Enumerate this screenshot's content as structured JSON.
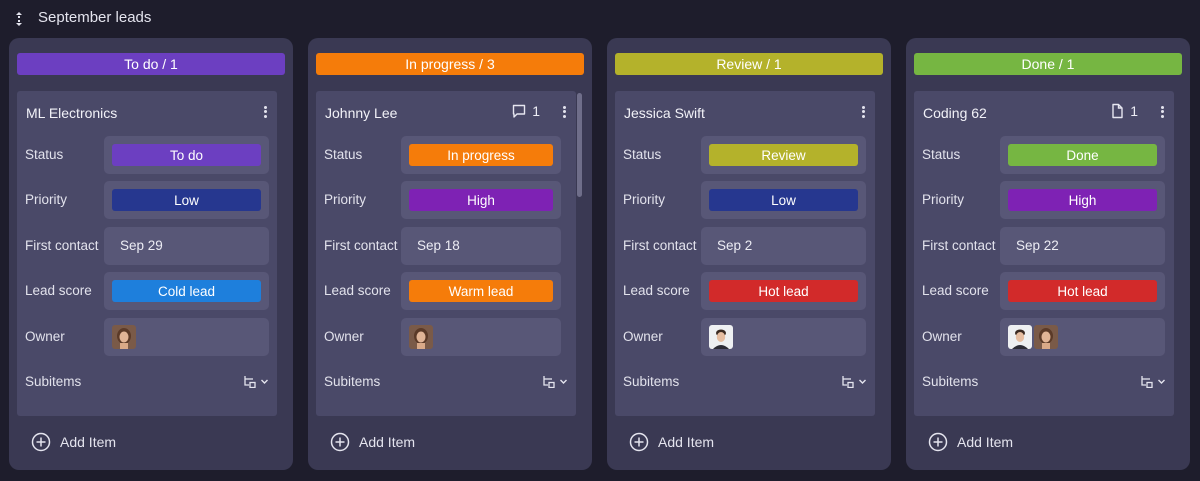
{
  "board": {
    "title": "September leads"
  },
  "labels": {
    "status": "Status",
    "priority": "Priority",
    "first_contact": "First contact",
    "lead_score": "Lead score",
    "owner": "Owner",
    "subitems": "Subitems",
    "add_item": "Add Item"
  },
  "columns": [
    {
      "header": "To do / 1",
      "color": "#6c3fc1",
      "card": {
        "title": "ML Electronics",
        "status": "To do",
        "status_color": "#6c3fc1",
        "priority": "Low",
        "priority_color": "#26378f",
        "first_contact": "Sep 29",
        "lead_score": "Cold lead",
        "lead_score_color": "#1e7fdc",
        "owners": [
          "woman-avatar"
        ]
      }
    },
    {
      "header": "In progress / 3",
      "color": "#f57c0a",
      "card": {
        "title": "Johnny Lee",
        "counter": "1",
        "counter_icon": "comment-icon",
        "status": "In progress",
        "status_color": "#f57c0a",
        "priority": "High",
        "priority_color": "#7e22b4",
        "first_contact": "Sep 18",
        "lead_score": "Warm lead",
        "lead_score_color": "#f57c0a",
        "owners": [
          "woman-avatar"
        ]
      }
    },
    {
      "header": "Review / 1",
      "color": "#b4b22b",
      "card": {
        "title": "Jessica Swift",
        "status": "Review",
        "status_color": "#b4b22b",
        "priority": "Low",
        "priority_color": "#26378f",
        "first_contact": "Sep 2",
        "lead_score": "Hot lead",
        "lead_score_color": "#d22a2a",
        "owners": [
          "man-avatar"
        ]
      }
    },
    {
      "header": "Done / 1",
      "color": "#76b642",
      "card": {
        "title": "Coding 62",
        "counter": "1",
        "counter_icon": "file-icon",
        "status": "Done",
        "status_color": "#76b642",
        "priority": "High",
        "priority_color": "#7e22b4",
        "first_contact": "Sep 22",
        "lead_score": "Hot lead",
        "lead_score_color": "#d22a2a",
        "owners": [
          "man-avatar",
          "woman-avatar"
        ]
      }
    }
  ]
}
